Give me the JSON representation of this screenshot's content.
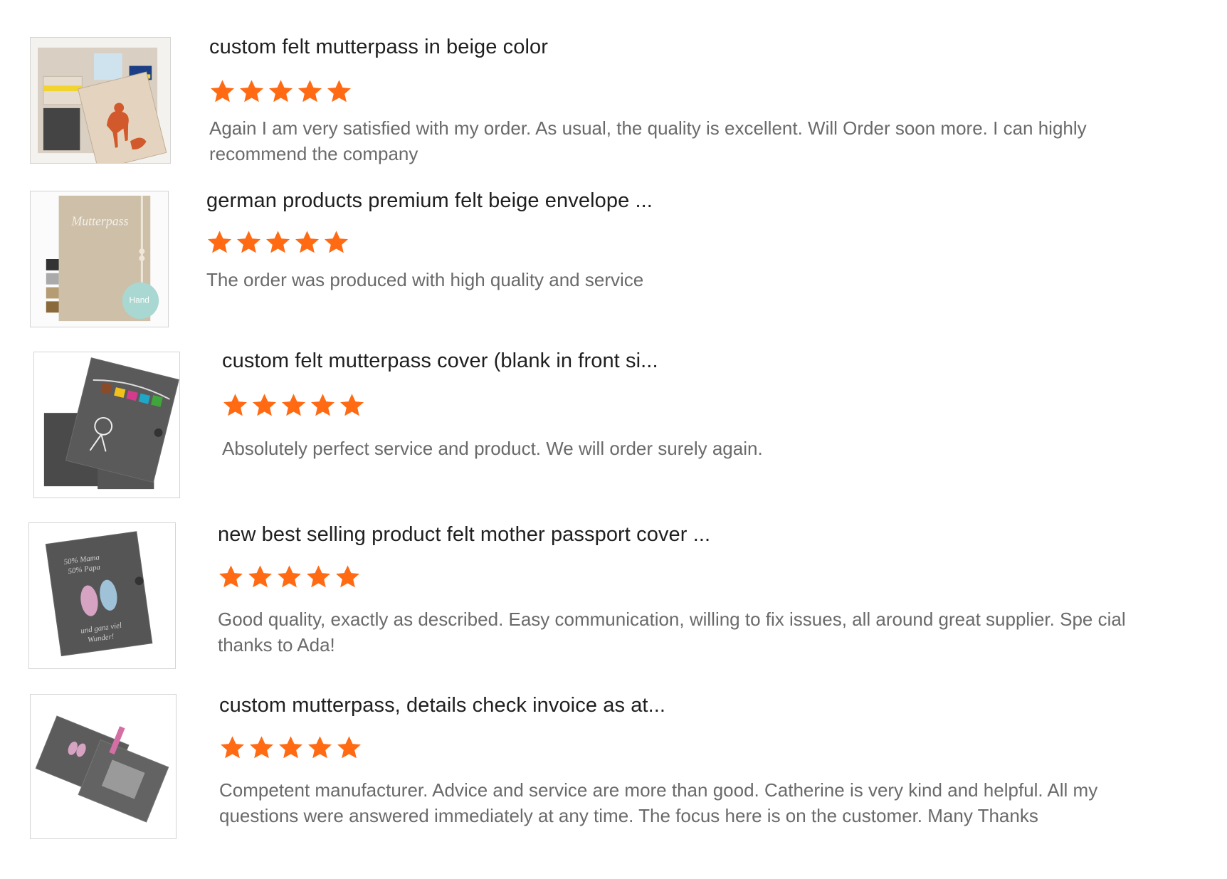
{
  "colors": {
    "star": "#ff6a13",
    "title": "#1f1f1f",
    "body_text": "#6a6a6a",
    "thumb_border": "#d4d4d4"
  },
  "reviews": [
    {
      "title": "custom felt mutterpass in beige color",
      "rating": 5,
      "text": "Again I am very satisfied with my order. As usual, the quality is excellent. Will Order soon more. I can highly recommend the company",
      "thumb_icon": "beige-felt-mutterpass-fawn-image"
    },
    {
      "title": "german products premium felt beige envelope ...",
      "rating": 5,
      "text": "The order was produced with high quality and service",
      "thumb_icon": "beige-felt-envelope-image"
    },
    {
      "title": "custom felt mutterpass cover (blank in front si...",
      "rating": 5,
      "text": "Absolutely perfect service and product. We will order surely again.",
      "thumb_icon": "grey-felt-cover-clothesline-image"
    },
    {
      "title": "new best selling product felt mother passport cover ...",
      "rating": 5,
      "text": "Good quality, exactly as described. Easy communication, willing to fix issues, all around great supplier. Spe cial thanks to Ada!",
      "thumb_icon": "grey-felt-cover-footprints-image"
    },
    {
      "title": "custom mutterpass, details check invoice as at...",
      "rating": 5,
      "text": "Competent manufacturer.  Advice and service are more than good.  Catherine is very kind and helpful.  All my questions were answered immediately at any time.  The focus here is on the customer.  Many Thanks",
      "thumb_icon": "grey-felt-open-wallet-image"
    }
  ]
}
